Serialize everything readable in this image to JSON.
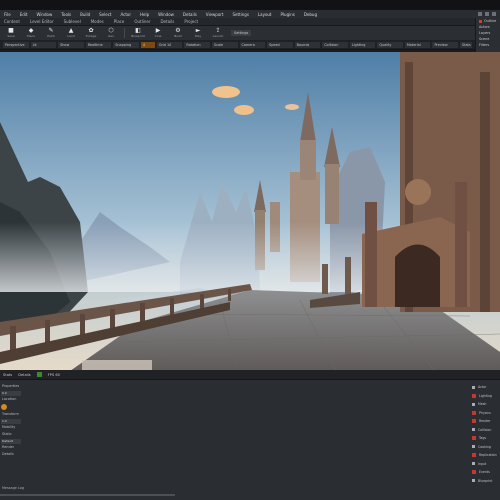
{
  "menu": {
    "items": [
      "File",
      "Edit",
      "Window",
      "Tools",
      "Build",
      "Select",
      "Actor",
      "Help",
      "Window",
      "Details",
      "Viewport",
      "Settings",
      "Layout",
      "Plugins",
      "Debug"
    ]
  },
  "row2": {
    "items": [
      "Content",
      "Level Editor",
      "Sublevel",
      "Modes",
      "Place",
      "Outliner",
      "Details",
      "Project"
    ]
  },
  "toolbar": {
    "tools": [
      {
        "icon": "save-icon",
        "glyph": "■",
        "label": "Save"
      },
      {
        "icon": "cube-icon",
        "glyph": "◆",
        "label": "Place"
      },
      {
        "icon": "paint-icon",
        "glyph": "✎",
        "label": "Paint"
      },
      {
        "icon": "landscape-icon",
        "glyph": "▲",
        "label": "Land"
      },
      {
        "icon": "foliage-icon",
        "glyph": "✿",
        "label": "Foliage"
      },
      {
        "icon": "geometry-icon",
        "glyph": "⬡",
        "label": "Geo"
      },
      {
        "icon": "blueprint-icon",
        "glyph": "◧",
        "label": "Blueprint"
      },
      {
        "icon": "cinematic-icon",
        "glyph": "▶",
        "label": "Cine"
      },
      {
        "icon": "build-icon",
        "glyph": "⚙",
        "label": "Build"
      },
      {
        "icon": "play-icon",
        "glyph": "►",
        "label": "Play"
      },
      {
        "icon": "launch-icon",
        "glyph": "⇪",
        "label": "Launch"
      }
    ],
    "tab_label": "Settings"
  },
  "propbar": {
    "cells": [
      "Perspective",
      "Lit",
      "Show",
      "Realtime",
      "Snapping",
      "Grid 10",
      "Rotation",
      "Scale",
      "Camera",
      "Speed",
      "Bounds",
      "Collision",
      "Lighting",
      "Quality",
      "Material",
      "Preview",
      "Stats",
      "Viewport"
    ],
    "accent_cell": "4"
  },
  "right_panel": {
    "items": [
      "Outline",
      "Actors",
      "Layers",
      "Scene",
      "Filters"
    ]
  },
  "viewport_status": {
    "items": [
      "Stats",
      "Details",
      "FPS 60"
    ]
  },
  "bottom_left": {
    "lines": [
      "Properties",
      "Location",
      "Transform",
      "Mobility",
      "Static",
      "Render",
      "Details"
    ],
    "fields": [
      "0.0",
      "1.0",
      "Default"
    ]
  },
  "bottom_right": {
    "items": [
      "Actor",
      "Lighting",
      "Mesh",
      "Physics",
      "Render",
      "Collision",
      "Tags",
      "Cooking",
      "Replication",
      "Input",
      "Events",
      "Blueprint"
    ]
  },
  "bottom_label": "Message Log",
  "colors": {
    "accent": "#d38a1e",
    "warning_red": "#c23a2e",
    "panel_bg": "#2a2d31"
  }
}
